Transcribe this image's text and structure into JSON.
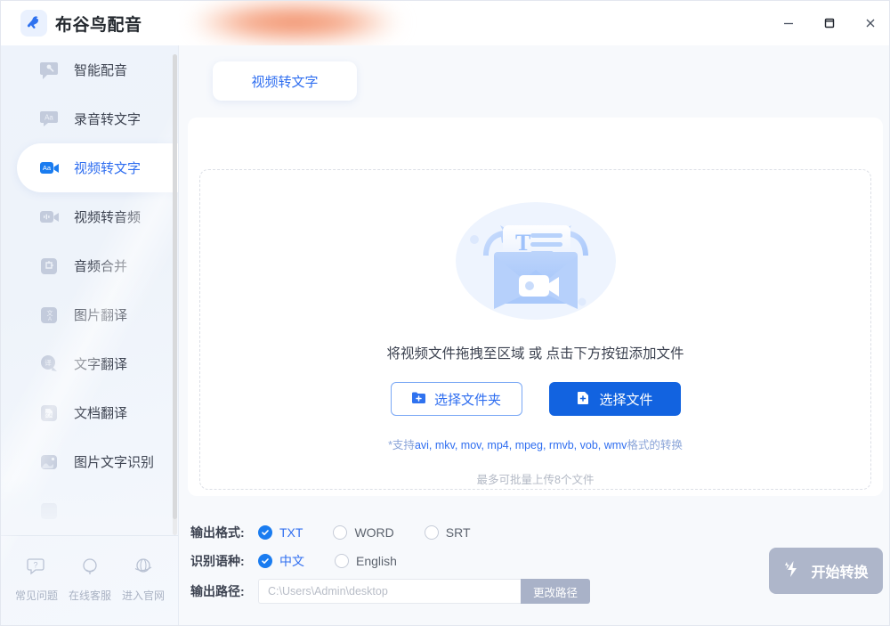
{
  "app": {
    "brand_name": "布谷鸟配音",
    "logo_icon": "bird-logo-icon",
    "accent_color": "#1263e0",
    "accent_light": "#2f6ef0"
  },
  "titlebar": {
    "minimize_icon": "minimize-icon",
    "maximize_icon": "maximize-icon",
    "close_icon": "close-icon"
  },
  "sidebar": {
    "items": [
      {
        "label": "智能配音",
        "icon": "voice-bubble-icon",
        "active": false
      },
      {
        "label": "录音转文字",
        "icon": "audio-to-text-icon",
        "active": false
      },
      {
        "label": "视频转文字",
        "icon": "video-to-text-icon",
        "active": true
      },
      {
        "label": "视频转音频",
        "icon": "video-to-audio-icon",
        "active": false
      },
      {
        "label": "音频合并",
        "icon": "audio-merge-icon",
        "active": false
      },
      {
        "label": "图片翻译",
        "icon": "image-translate-icon",
        "active": false
      },
      {
        "label": "文字翻译",
        "icon": "text-translate-icon",
        "active": false
      },
      {
        "label": "文档翻译",
        "icon": "document-translate-icon",
        "active": false
      },
      {
        "label": "图片文字识别",
        "icon": "image-ocr-icon",
        "active": false
      },
      {
        "label": "",
        "icon": "hidden-item-icon",
        "active": false
      }
    ],
    "footer": [
      {
        "label": "常见问题",
        "icon": "question-circle-icon"
      },
      {
        "label": "在线客服",
        "icon": "headset-support-icon"
      },
      {
        "label": "进入官网",
        "icon": "globe-icon"
      }
    ]
  },
  "main": {
    "tab_label": "视频转文字",
    "dropzone": {
      "illustration_icon": "video-to-text-illustration",
      "title": "将视频文件拖拽至区域 或 点击下方按钮添加文件",
      "choose_folder_label": "选择文件夹",
      "choose_folder_icon": "folder-plus-icon",
      "choose_file_label": "选择文件",
      "choose_file_icon": "file-plus-icon",
      "formats_prefix": "*支持",
      "formats_list": "avi, mkv, mov, mp4, mpeg, rmvb, vob, wmv",
      "formats_suffix": "格式的转换",
      "max_files_note": "最多可批量上传8个文件"
    }
  },
  "options": {
    "output_format_label": "输出格式:",
    "output_formats": [
      {
        "label": "TXT",
        "selected": true
      },
      {
        "label": "WORD",
        "selected": false
      },
      {
        "label": "SRT",
        "selected": false
      }
    ],
    "language_label": "识别语种:",
    "languages": [
      {
        "label": "中文",
        "selected": true
      },
      {
        "label": "English",
        "selected": false
      }
    ],
    "output_path_label": "输出路径:",
    "output_path_placeholder": "C:\\Users\\Admin\\desktop",
    "output_path_value": "",
    "change_path_label": "更改路径",
    "start_label": "开始转换",
    "start_icon": "lightning-convert-icon"
  }
}
